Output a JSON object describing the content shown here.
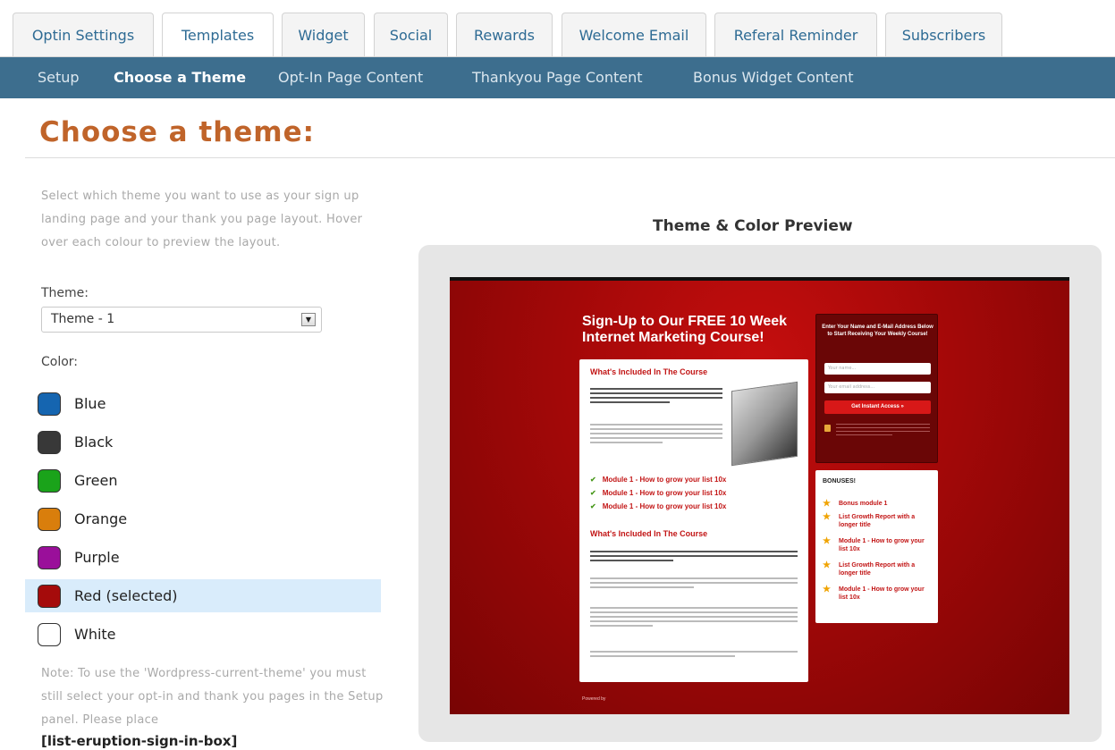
{
  "tabs": [
    {
      "label": "Optin Settings"
    },
    {
      "label": "Templates"
    },
    {
      "label": "Widget"
    },
    {
      "label": "Social"
    },
    {
      "label": "Rewards"
    },
    {
      "label": "Welcome Email"
    },
    {
      "label": "Referal Reminder"
    },
    {
      "label": "Subscribers"
    }
  ],
  "subnav": [
    {
      "label": "Setup"
    },
    {
      "label": "Choose a Theme"
    },
    {
      "label": "Opt-In Page Content"
    },
    {
      "label": "Thankyou Page Content"
    },
    {
      "label": "Bonus Widget Content"
    }
  ],
  "page_title": "Choose a theme:",
  "intro_text": "Select which theme you want to use as your sign up landing page and your thank you page layout. Hover over each colour to preview the layout.",
  "theme": {
    "label": "Theme:",
    "selected": "Theme - 1"
  },
  "color": {
    "label": "Color:",
    "options": [
      {
        "name": "Blue",
        "hex": "#1565b0"
      },
      {
        "name": "Black",
        "hex": "#383838"
      },
      {
        "name": "Green",
        "hex": "#1aa31a"
      },
      {
        "name": "Orange",
        "hex": "#d97e0c"
      },
      {
        "name": "Purple",
        "hex": "#9a0f9a"
      },
      {
        "name": "Red  (selected)",
        "hex": "#a50b0b"
      },
      {
        "name": "White",
        "hex": "#ffffff"
      }
    ]
  },
  "note_text": "Note: To use the 'Wordpress-current-theme' you must still select your opt-in and thank you pages in the Setup panel. Please place",
  "shortcode": "[list-eruption-sign-in-box]",
  "preview": {
    "title": "Theme & Color Preview",
    "headline": "Sign-Up to Our FREE 10 Week Internet Marketing Course!",
    "section_heading": "What's Included In The Course",
    "modules": [
      "Module 1 - How to grow your list 10x",
      "Module 1 - How to grow your list 10x",
      "Module 1 - How to grow your list 10x"
    ],
    "optin_title": "Enter Your Name and E-Mail Address Below to Start Receiving Your Weekly Course!",
    "name_placeholder": "Your name...",
    "email_placeholder": "Your email address...",
    "button": "Get Instant Access »",
    "bonuses_title": "BONUSES!",
    "bonuses": [
      "Bonus module 1",
      "List Growth Report with a longer title",
      "Module 1 - How to grow your list 10x",
      "List Growth Report with a longer title",
      "Module 1 - How to grow your list 10x"
    ],
    "powered": "Powered by"
  }
}
